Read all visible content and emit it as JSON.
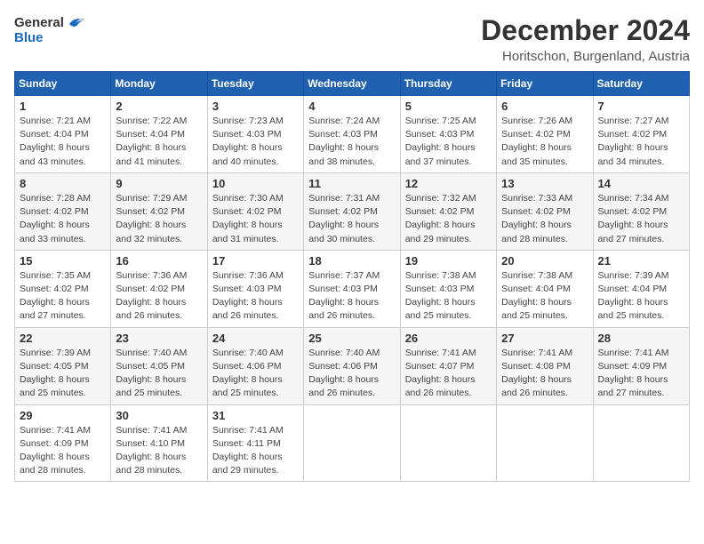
{
  "header": {
    "logo": {
      "general": "General",
      "blue": "Blue"
    },
    "title": "December 2024",
    "location": "Horitschon, Burgenland, Austria"
  },
  "calendar": {
    "days_of_week": [
      "Sunday",
      "Monday",
      "Tuesday",
      "Wednesday",
      "Thursday",
      "Friday",
      "Saturday"
    ],
    "weeks": [
      [
        null,
        {
          "day": 2,
          "sunrise": "7:22 AM",
          "sunset": "4:04 PM",
          "daylight": "8 hours and 41 minutes."
        },
        {
          "day": 3,
          "sunrise": "7:23 AM",
          "sunset": "4:03 PM",
          "daylight": "8 hours and 40 minutes."
        },
        {
          "day": 4,
          "sunrise": "7:24 AM",
          "sunset": "4:03 PM",
          "daylight": "8 hours and 38 minutes."
        },
        {
          "day": 5,
          "sunrise": "7:25 AM",
          "sunset": "4:03 PM",
          "daylight": "8 hours and 37 minutes."
        },
        {
          "day": 6,
          "sunrise": "7:26 AM",
          "sunset": "4:02 PM",
          "daylight": "8 hours and 35 minutes."
        },
        {
          "day": 7,
          "sunrise": "7:27 AM",
          "sunset": "4:02 PM",
          "daylight": "8 hours and 34 minutes."
        }
      ],
      [
        {
          "day": 1,
          "sunrise": "7:21 AM",
          "sunset": "4:04 PM",
          "daylight": "8 hours and 43 minutes."
        },
        null,
        null,
        null,
        null,
        null,
        null
      ],
      [
        {
          "day": 8,
          "sunrise": "7:28 AM",
          "sunset": "4:02 PM",
          "daylight": "8 hours and 33 minutes."
        },
        {
          "day": 9,
          "sunrise": "7:29 AM",
          "sunset": "4:02 PM",
          "daylight": "8 hours and 32 minutes."
        },
        {
          "day": 10,
          "sunrise": "7:30 AM",
          "sunset": "4:02 PM",
          "daylight": "8 hours and 31 minutes."
        },
        {
          "day": 11,
          "sunrise": "7:31 AM",
          "sunset": "4:02 PM",
          "daylight": "8 hours and 30 minutes."
        },
        {
          "day": 12,
          "sunrise": "7:32 AM",
          "sunset": "4:02 PM",
          "daylight": "8 hours and 29 minutes."
        },
        {
          "day": 13,
          "sunrise": "7:33 AM",
          "sunset": "4:02 PM",
          "daylight": "8 hours and 28 minutes."
        },
        {
          "day": 14,
          "sunrise": "7:34 AM",
          "sunset": "4:02 PM",
          "daylight": "8 hours and 27 minutes."
        }
      ],
      [
        {
          "day": 15,
          "sunrise": "7:35 AM",
          "sunset": "4:02 PM",
          "daylight": "8 hours and 27 minutes."
        },
        {
          "day": 16,
          "sunrise": "7:36 AM",
          "sunset": "4:02 PM",
          "daylight": "8 hours and 26 minutes."
        },
        {
          "day": 17,
          "sunrise": "7:36 AM",
          "sunset": "4:03 PM",
          "daylight": "8 hours and 26 minutes."
        },
        {
          "day": 18,
          "sunrise": "7:37 AM",
          "sunset": "4:03 PM",
          "daylight": "8 hours and 26 minutes."
        },
        {
          "day": 19,
          "sunrise": "7:38 AM",
          "sunset": "4:03 PM",
          "daylight": "8 hours and 25 minutes."
        },
        {
          "day": 20,
          "sunrise": "7:38 AM",
          "sunset": "4:04 PM",
          "daylight": "8 hours and 25 minutes."
        },
        {
          "day": 21,
          "sunrise": "7:39 AM",
          "sunset": "4:04 PM",
          "daylight": "8 hours and 25 minutes."
        }
      ],
      [
        {
          "day": 22,
          "sunrise": "7:39 AM",
          "sunset": "4:05 PM",
          "daylight": "8 hours and 25 minutes."
        },
        {
          "day": 23,
          "sunrise": "7:40 AM",
          "sunset": "4:05 PM",
          "daylight": "8 hours and 25 minutes."
        },
        {
          "day": 24,
          "sunrise": "7:40 AM",
          "sunset": "4:06 PM",
          "daylight": "8 hours and 25 minutes."
        },
        {
          "day": 25,
          "sunrise": "7:40 AM",
          "sunset": "4:06 PM",
          "daylight": "8 hours and 26 minutes."
        },
        {
          "day": 26,
          "sunrise": "7:41 AM",
          "sunset": "4:07 PM",
          "daylight": "8 hours and 26 minutes."
        },
        {
          "day": 27,
          "sunrise": "7:41 AM",
          "sunset": "4:08 PM",
          "daylight": "8 hours and 26 minutes."
        },
        {
          "day": 28,
          "sunrise": "7:41 AM",
          "sunset": "4:09 PM",
          "daylight": "8 hours and 27 minutes."
        }
      ],
      [
        {
          "day": 29,
          "sunrise": "7:41 AM",
          "sunset": "4:09 PM",
          "daylight": "8 hours and 28 minutes."
        },
        {
          "day": 30,
          "sunrise": "7:41 AM",
          "sunset": "4:10 PM",
          "daylight": "8 hours and 28 minutes."
        },
        {
          "day": 31,
          "sunrise": "7:41 AM",
          "sunset": "4:11 PM",
          "daylight": "8 hours and 29 minutes."
        },
        null,
        null,
        null,
        null
      ]
    ]
  }
}
